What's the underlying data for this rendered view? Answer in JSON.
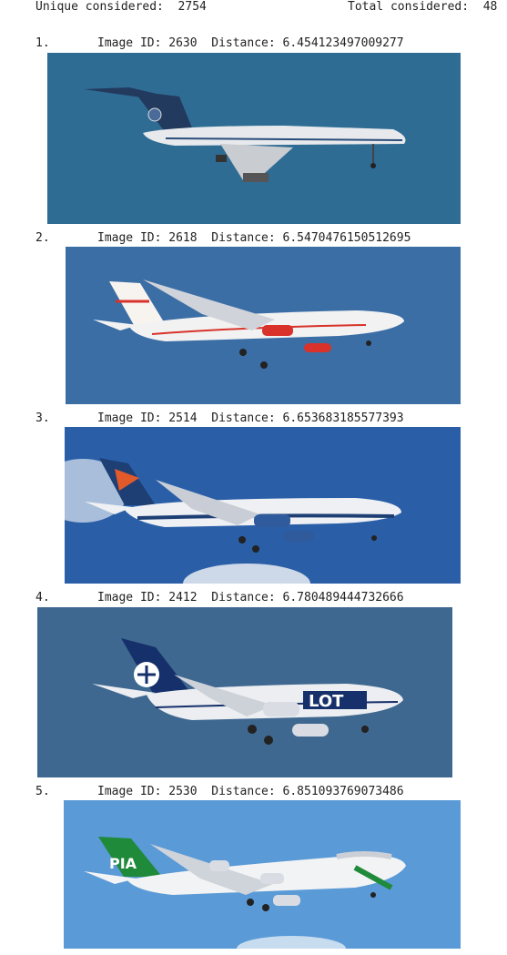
{
  "header": {
    "unique_label": "Unique considered:",
    "unique_value": "2754",
    "total_label": "Total considered:",
    "total_value": "48"
  },
  "results": [
    {
      "rank": "1.",
      "id_label": "Image ID:",
      "id": "2630",
      "dist_label": "Distance:",
      "distance": "6.454123497009277",
      "image": {
        "sky": "#2f6c94",
        "body": "#e7e9ec",
        "tail": "#223a5e",
        "logo": "#4a6a9a",
        "description_icon": "tu134-aircraft-photo"
      }
    },
    {
      "rank": "2.",
      "id_label": "Image ID:",
      "id": "2618",
      "dist_label": "Distance:",
      "distance": "6.5470476150512695",
      "image": {
        "sky": "#3b6ea5",
        "body": "#f2f2f2",
        "tail": "#f7f4f0",
        "logo": "#d8322a",
        "description_icon": "a310-aircraft-photo"
      }
    },
    {
      "rank": "3.",
      "id_label": "Image ID:",
      "id": "2514",
      "dist_label": "Distance:",
      "distance": "6.653683185577393",
      "image": {
        "sky": "#2a5fa8",
        "body": "#eef0f4",
        "tail": "#1d3f74",
        "logo": "#e25a2a",
        "description_icon": "b767-aircraft-photo"
      }
    },
    {
      "rank": "4.",
      "id_label": "Image ID:",
      "id": "2412",
      "dist_label": "Distance:",
      "distance": "6.780489444732666",
      "image": {
        "sky": "#3f6890",
        "body": "#eceef2",
        "tail": "#15306a",
        "logo": "#15306a",
        "description_icon": "b737-aircraft-photo"
      }
    },
    {
      "rank": "5.",
      "id_label": "Image ID:",
      "id": "2530",
      "dist_label": "Distance:",
      "distance": "6.851093769073486",
      "image": {
        "sky": "#5a9ad6",
        "body": "#f2f3f4",
        "tail": "#1f8a3a",
        "logo": "#ffffff",
        "description_icon": "b747-aircraft-photo"
      }
    }
  ]
}
